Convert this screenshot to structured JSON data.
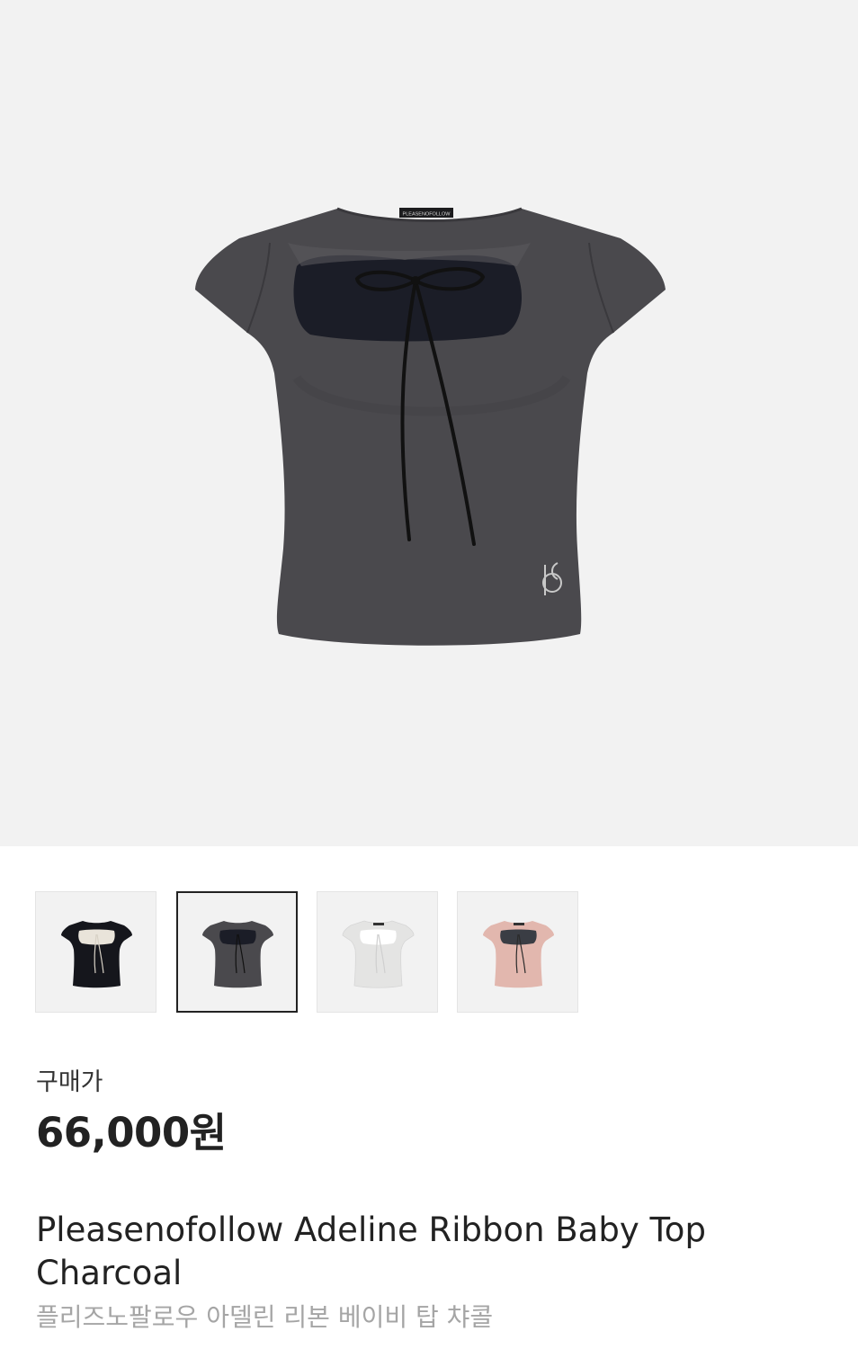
{
  "product": {
    "price_label": "구매가",
    "price": "66,000원",
    "title_en": "Pleasenofollow Adeline Ribbon Baby Top Charcoal",
    "title_ko": "플리즈노팔로우 아델린 리본 베이비 탑 챠콜",
    "brand_tag": "PLEASENOFOLLOW",
    "logo_mark": "PF"
  },
  "gallery": {
    "selected_index": 1,
    "variants": [
      {
        "color_name": "black",
        "body_color": "#15161c",
        "inner_color": "#e9e4da",
        "ribbon_color": "#d8d2c6"
      },
      {
        "color_name": "charcoal",
        "body_color": "#4a494d",
        "inner_color": "#1b1d27",
        "ribbon_color": "#111111"
      },
      {
        "color_name": "white",
        "body_color": "#ededec",
        "inner_color": "#ffffff",
        "ribbon_color": "#cfcfcf"
      },
      {
        "color_name": "pink",
        "body_color": "#e2b7ae",
        "inner_color": "#3a3d44",
        "ribbon_color": "#2b2b2b"
      }
    ]
  },
  "colors": {
    "hero_background": "#f2f2f2",
    "shirt": "#4a494d",
    "shirt_shadow": "#3e3d41",
    "inner_panel": "#1b1d27",
    "ribbon": "#111111",
    "price_text": "#222222",
    "subtitle_text": "#a5a5a5"
  }
}
